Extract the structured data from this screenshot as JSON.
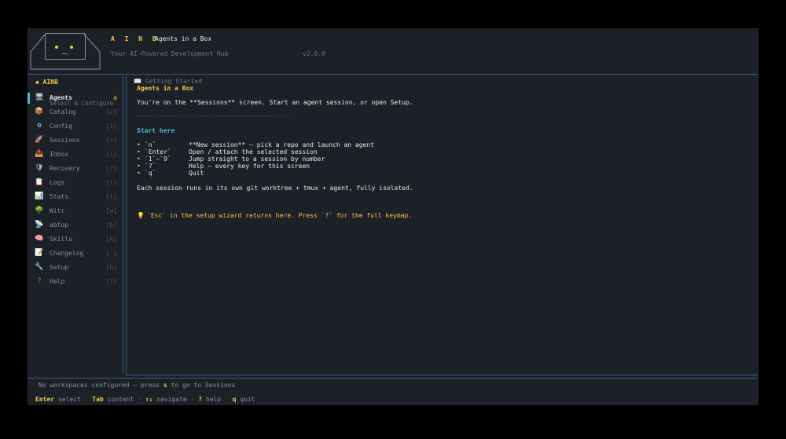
{
  "header": {
    "brand": "A I N B",
    "subtitle": "Agents in a Box",
    "tagline": "Your AI-Powered Development Hub",
    "version": "v2.0.0"
  },
  "sidebar": {
    "title": "◆ AINB",
    "hint": "Select & Configure",
    "items": [
      {
        "icon": "🖥",
        "icon_name": "monitor-icon",
        "label": "Agents",
        "key": "a",
        "active": true
      },
      {
        "icon": "📦",
        "icon_name": "package-icon",
        "label": "Catalog",
        "key": "[c]"
      },
      {
        "icon": "⚙",
        "icon_name": "gear-icon",
        "label": "Config",
        "key": "[i]"
      },
      {
        "icon": "🚀",
        "icon_name": "rocket-icon",
        "label": "Sessions",
        "key": "[s]"
      },
      {
        "icon": "📥",
        "icon_name": "inbox-icon",
        "label": "Inbox",
        "key": "[i]"
      },
      {
        "icon": "🛡",
        "icon_name": "shield-icon",
        "label": "Recovery",
        "key": "[r]"
      },
      {
        "icon": "📋",
        "icon_name": "clipboard-icon",
        "label": "Logs",
        "key": "[l]"
      },
      {
        "icon": "📊",
        "icon_name": "chart-icon",
        "label": "Stats",
        "key": "[t]"
      },
      {
        "icon": "🌳",
        "icon_name": "tree-icon",
        "label": "Witr",
        "key": "[w]"
      },
      {
        "icon": "📡",
        "icon_name": "satellite-icon",
        "label": "abtop",
        "key": "[b]"
      },
      {
        "icon": "🧠",
        "icon_name": "brain-icon",
        "label": "Skills",
        "key": "[k]"
      },
      {
        "icon": "📝",
        "icon_name": "memo-icon",
        "label": "Changelog",
        "key": "[-]"
      },
      {
        "icon": "🔧",
        "icon_name": "wrench-icon",
        "label": "Setup",
        "key": "[h]"
      },
      {
        "icon": "?",
        "icon_name": "question-icon",
        "label": "Help",
        "key": "[?]"
      }
    ]
  },
  "content": {
    "tab_label": "Getting Started",
    "title": "Agents in a Box",
    "intro": "You're on the **Sessions** screen. Start an agent session, or open Setup.",
    "section": "Start here",
    "keys": [
      {
        "key": "`n`",
        "desc": "**New session** — pick a repo and launch an agent"
      },
      {
        "key": "`Enter`",
        "desc": "Open / attach the selected session"
      },
      {
        "key": "`1`–`9`",
        "desc": "Jump straight to a session by number"
      },
      {
        "key": "`?`",
        "desc": "Help — every key for this screen"
      },
      {
        "key": "`q`",
        "desc": "Quit"
      }
    ],
    "note": "Each session runs in its own git worktree + tmux + agent, fully isolated.",
    "tip": "`Esc` in the setup wizard returns here. Press `?` for the full keymap."
  },
  "footer": {
    "status_pre": "No workspaces configured — press ",
    "status_key": "s",
    "status_post": " to go to Sessions",
    "hints": [
      {
        "key": "Enter",
        "label": "select"
      },
      {
        "key": "Tab",
        "label": "content"
      },
      {
        "key": "↑↓",
        "label": "navigate"
      },
      {
        "key": "?",
        "label": "help"
      },
      {
        "key": "q",
        "label": "quit"
      }
    ]
  },
  "colors": {
    "background": "#1c2027",
    "accent": "#f2c94c",
    "border": "#3a5a8c",
    "section": "#4db8d9"
  }
}
